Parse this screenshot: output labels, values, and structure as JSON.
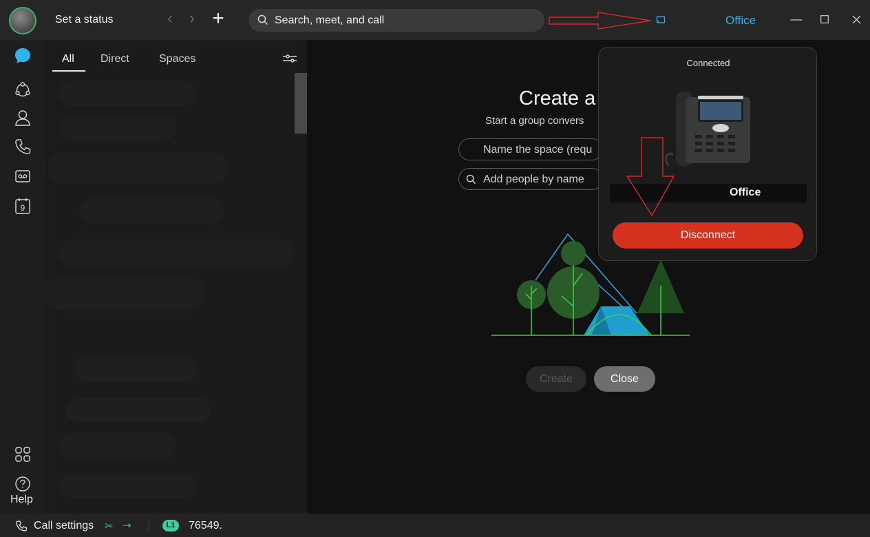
{
  "titlebar": {
    "status_label": "Set a status",
    "search_placeholder": "Search, meet, and call",
    "connected_device": "Office"
  },
  "list_panel": {
    "tabs": [
      {
        "label": "All",
        "active": true
      },
      {
        "label": "Direct",
        "active": false
      },
      {
        "label": "Spaces",
        "active": false
      }
    ]
  },
  "rail": {
    "help_label": "Help",
    "calendar_day": "9"
  },
  "main": {
    "title": "Create a",
    "subtitle": "Start a group convers",
    "space_name_placeholder": "Name the space (requ",
    "add_people_placeholder": "Add people by name",
    "create_label": "Create",
    "close_label": "Close"
  },
  "popover": {
    "status": "Connected",
    "device_name": "Office",
    "disconnect_label": "Disconnect"
  },
  "statusbar": {
    "call_settings_label": "Call settings",
    "line_badge": "L1",
    "number": "76549."
  },
  "colors": {
    "accent": "#2fb3ef",
    "disconnect": "#d4311f",
    "presence": "#3bb36a",
    "line_badge": "#3ecf9b",
    "annotation_arrow": "#d42a2a"
  }
}
